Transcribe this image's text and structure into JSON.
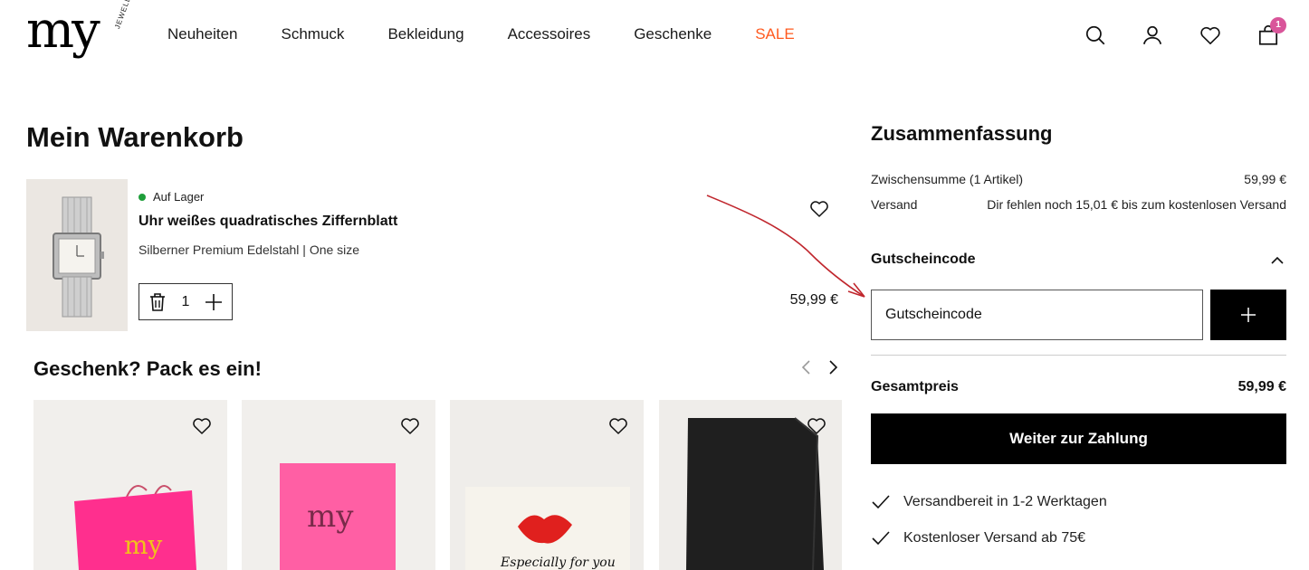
{
  "brand": {
    "logo_text": "my",
    "logo_sub": "JEWELLERY"
  },
  "nav": {
    "items": [
      "Neuheiten",
      "Schmuck",
      "Bekleidung",
      "Accessoires",
      "Geschenke",
      "SALE"
    ],
    "sale_color": "#ff5a1f"
  },
  "header_icons": [
    "search-icon",
    "account-icon",
    "wishlist-icon",
    "cart-icon"
  ],
  "cart_count": "1",
  "cart": {
    "title": "Mein Warenkorb",
    "item": {
      "stock": "Auf Lager",
      "name": "Uhr weißes quadratisches Ziffernblatt",
      "variant": "Silberner Premium Edelstahl | One size",
      "quantity": "1",
      "price": "59,99 €"
    }
  },
  "gift": {
    "title": "Geschenk? Pack es ein!",
    "cards": [
      {
        "name": "gift-bag-pink",
        "logo": "my"
      },
      {
        "name": "gift-box-pink",
        "logo": "my"
      },
      {
        "name": "gift-card-lips",
        "text": "Especially for you"
      },
      {
        "name": "gift-bag-black"
      }
    ]
  },
  "summary": {
    "title": "Zusammenfassung",
    "subtotal_label": "Zwischensumme (1 Artikel)",
    "subtotal_value": "59,99 €",
    "shipping_label": "Versand",
    "shipping_value": "Dir fehlen noch 15,01 € bis zum kostenlosen Versand",
    "coupon_title": "Gutscheincode",
    "coupon_placeholder": "Gutscheincode",
    "total_label": "Gesamtpreis",
    "total_value": "59,99 €",
    "checkout_label": "Weiter zur Zahlung",
    "usps": [
      "Versandbereit in 1-2 Werktagen",
      "Kostenloser Versand ab 75€"
    ]
  },
  "colors": {
    "badge": "#d9559a",
    "stock_dot": "#1e9e3a",
    "annotation_arrow": "#c0262d",
    "gift_pink": "#ff2f8e"
  }
}
